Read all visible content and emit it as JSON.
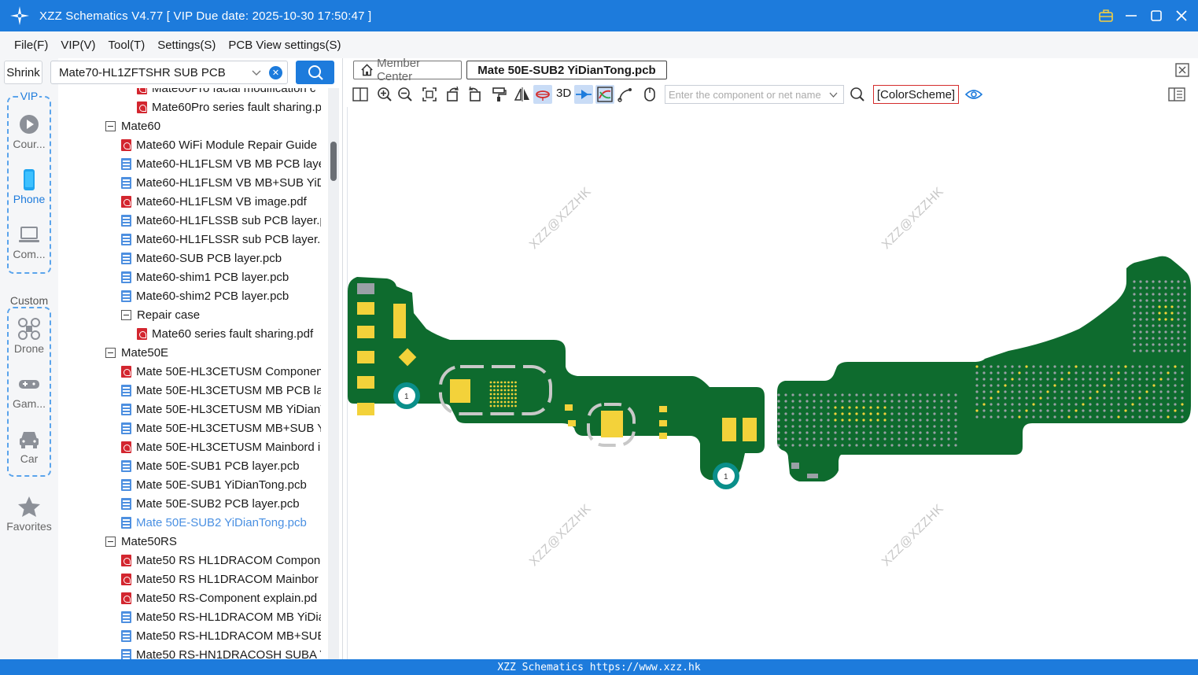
{
  "app": {
    "title": "XZZ Schematics V4.77 [ VIP Due date: 2025-10-30 17:50:47 ]"
  },
  "menu": [
    "File(F)",
    "VIP(V)",
    "Tool(T)",
    "Settings(S)",
    "PCB View settings(S)"
  ],
  "sidebar": {
    "shrink_label": "Shrink",
    "vip_label": "VIP",
    "custom_label": "Custom",
    "vip_items": [
      {
        "label": "Cour...",
        "icon": "play-circle-icon"
      },
      {
        "label": "Phone",
        "icon": "phone-icon",
        "active": true
      },
      {
        "label": "Com...",
        "icon": "laptop-icon"
      }
    ],
    "custom_items": [
      {
        "label": "Drone",
        "icon": "drone-icon"
      },
      {
        "label": "Gam...",
        "icon": "gamepad-icon"
      },
      {
        "label": "Car",
        "icon": "car-icon"
      }
    ],
    "favorites_label": "Favorites"
  },
  "search": {
    "value": "Mate70-HL1ZFTSHR SUB PCB"
  },
  "tree": [
    {
      "level": 2,
      "type": "pdf",
      "label": "Mate60Pro facial modification c"
    },
    {
      "level": 2,
      "type": "pdf",
      "label": "Mate60Pro series fault sharing.p"
    },
    {
      "level": 0,
      "type": "folder",
      "label": "Mate60"
    },
    {
      "level": 1,
      "type": "pdf",
      "label": "Mate60 WiFi Module Repair Guide"
    },
    {
      "level": 1,
      "type": "pcb",
      "label": "Mate60-HL1FLSM VB MB PCB laye"
    },
    {
      "level": 1,
      "type": "pcb",
      "label": "Mate60-HL1FLSM VB MB+SUB YiD"
    },
    {
      "level": 1,
      "type": "pdf",
      "label": "Mate60-HL1FLSM VB image.pdf"
    },
    {
      "level": 1,
      "type": "pcb",
      "label": "Mate60-HL1FLSSB sub PCB layer.p"
    },
    {
      "level": 1,
      "type": "pcb",
      "label": "Mate60-HL1FLSSR sub PCB layer.p"
    },
    {
      "level": 1,
      "type": "pcb",
      "label": "Mate60-SUB PCB layer.pcb"
    },
    {
      "level": 1,
      "type": "pcb",
      "label": "Mate60-shim1 PCB layer.pcb"
    },
    {
      "level": 1,
      "type": "pcb",
      "label": "Mate60-shim2 PCB layer.pcb"
    },
    {
      "level": 1,
      "type": "folder",
      "label": "Repair case"
    },
    {
      "level": 2,
      "type": "pdf",
      "label": "Mate60 series fault sharing.pdf"
    },
    {
      "level": 0,
      "type": "folder",
      "label": "Mate50E"
    },
    {
      "level": 1,
      "type": "pdf",
      "label": "Mate 50E-HL3CETUSM Componen"
    },
    {
      "level": 1,
      "type": "pcb",
      "label": "Mate 50E-HL3CETUSM MB PCB lay"
    },
    {
      "level": 1,
      "type": "pcb",
      "label": "Mate 50E-HL3CETUSM MB YiDianT"
    },
    {
      "level": 1,
      "type": "pcb",
      "label": "Mate 50E-HL3CETUSM MB+SUB Yi"
    },
    {
      "level": 1,
      "type": "pdf",
      "label": "Mate 50E-HL3CETUSM Mainbord i"
    },
    {
      "level": 1,
      "type": "pcb",
      "label": "Mate 50E-SUB1 PCB layer.pcb"
    },
    {
      "level": 1,
      "type": "pcb",
      "label": "Mate 50E-SUB1 YiDianTong.pcb"
    },
    {
      "level": 1,
      "type": "pcb",
      "label": "Mate 50E-SUB2 PCB layer.pcb"
    },
    {
      "level": 1,
      "type": "pcb",
      "label": "Mate 50E-SUB2 YiDianTong.pcb",
      "selected": true
    },
    {
      "level": 0,
      "type": "folder",
      "label": "Mate50RS"
    },
    {
      "level": 1,
      "type": "pdf",
      "label": "Mate50 RS HL1DRACOM Compone"
    },
    {
      "level": 1,
      "type": "pdf",
      "label": "Mate50 RS HL1DRACOM Mainbor"
    },
    {
      "level": 1,
      "type": "pdf",
      "label": "Mate50 RS-Component explain.pd"
    },
    {
      "level": 1,
      "type": "pcb",
      "label": "Mate50 RS-HL1DRACOM MB YiDia"
    },
    {
      "level": 1,
      "type": "pcb",
      "label": "Mate50 RS-HL1DRACOM MB+SUB"
    },
    {
      "level": 1,
      "type": "pcb",
      "label": "Mate50 RS-HN1DRACOSH SUBA Y"
    }
  ],
  "tabs": {
    "member_center": "Member Center",
    "active": "Mate 50E-SUB2 YiDianTong.pcb"
  },
  "toolbar": {
    "three_d": "3D",
    "component_search_placeholder": "Enter the component or net name",
    "color_scheme": "[ColorScheme]"
  },
  "canvas": {
    "watermark": "XZZ@XZZHK",
    "test_point_label": "1",
    "board_color": "#0e6b2e",
    "pad_color": "#f3d23a"
  },
  "status": {
    "text": "XZZ Schematics https://www.xzz.hk"
  }
}
